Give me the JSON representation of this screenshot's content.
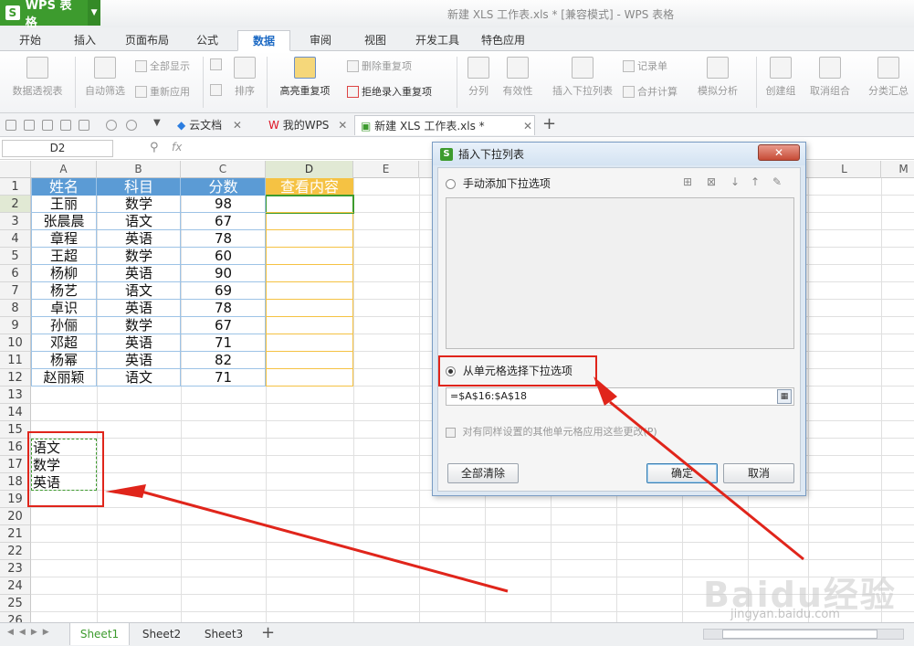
{
  "app": {
    "name": "WPS 表格",
    "window_title": "新建 XLS 工作表.xls * [兼容模式] - WPS 表格"
  },
  "ribbon_tabs": [
    "开始",
    "插入",
    "页面布局",
    "公式",
    "数据",
    "审阅",
    "视图",
    "开发工具",
    "特色应用"
  ],
  "active_tab": "数据",
  "ribbon": {
    "pivot": "数据透视表",
    "autofilter": "自动筛选",
    "show_all": "全部显示",
    "reapply": "重新应用",
    "sort": "排序",
    "highlight_dup": "高亮重复项",
    "delete_dup": "删除重复项",
    "reject_dup": "拒绝录入重复项",
    "split": "分列",
    "validity": "有效性",
    "insert_dropdown": "插入下拉列表",
    "records": "记录单",
    "merge_calc": "合并计算",
    "whatif": "模拟分析",
    "group": "创建组",
    "ungroup": "取消组合",
    "subtotal": "分类汇总"
  },
  "doc_tabs": [
    "云文档",
    "我的WPS",
    "新建 XLS 工作表.xls *"
  ],
  "formula_bar": {
    "name_box": "D2",
    "fx": "fx"
  },
  "columns": [
    "A",
    "B",
    "C",
    "D",
    "E",
    "L",
    "M"
  ],
  "table": {
    "headers": [
      "姓名",
      "科目",
      "分数",
      "查看内容"
    ],
    "rows": [
      [
        "王丽",
        "数学",
        "98"
      ],
      [
        "张晨晨",
        "语文",
        "67"
      ],
      [
        "章程",
        "英语",
        "78"
      ],
      [
        "王超",
        "数学",
        "60"
      ],
      [
        "杨柳",
        "英语",
        "90"
      ],
      [
        "杨艺",
        "语文",
        "69"
      ],
      [
        "卓识",
        "英语",
        "78"
      ],
      [
        "孙俪",
        "数学",
        "67"
      ],
      [
        "邓超",
        "英语",
        "71"
      ],
      [
        "杨幂",
        "英语",
        "82"
      ],
      [
        "赵丽颖",
        "语文",
        "71"
      ]
    ]
  },
  "options_list": [
    "语文",
    "数学",
    "英语"
  ],
  "row_numbers": [
    "1",
    "2",
    "3",
    "4",
    "5",
    "6",
    "7",
    "8",
    "9",
    "10",
    "11",
    "12",
    "13",
    "14",
    "15",
    "16",
    "17",
    "18",
    "19",
    "20",
    "21",
    "22",
    "23",
    "24",
    "25",
    "26"
  ],
  "dialog": {
    "title": "插入下拉列表",
    "close": "✕",
    "manual_option": "手动添加下拉选项",
    "cell_option": "从单元格选择下拉选项",
    "range": "=$A$16:$A$18",
    "apply_all": "对有同样设置的其他单元格应用这些更改(P)",
    "clear_all": "全部清除",
    "ok": "确定",
    "cancel": "取消"
  },
  "sheets": [
    "Sheet1",
    "Sheet2",
    "Sheet3"
  ],
  "watermark": {
    "main": "Baidu经验",
    "sub": "jingyan.baidu.com"
  },
  "colors": {
    "brand": "#3d9b2e",
    "header_fill": "#5b9bd5",
    "highlight": "#f5c243",
    "annotation": "#e0251b"
  }
}
